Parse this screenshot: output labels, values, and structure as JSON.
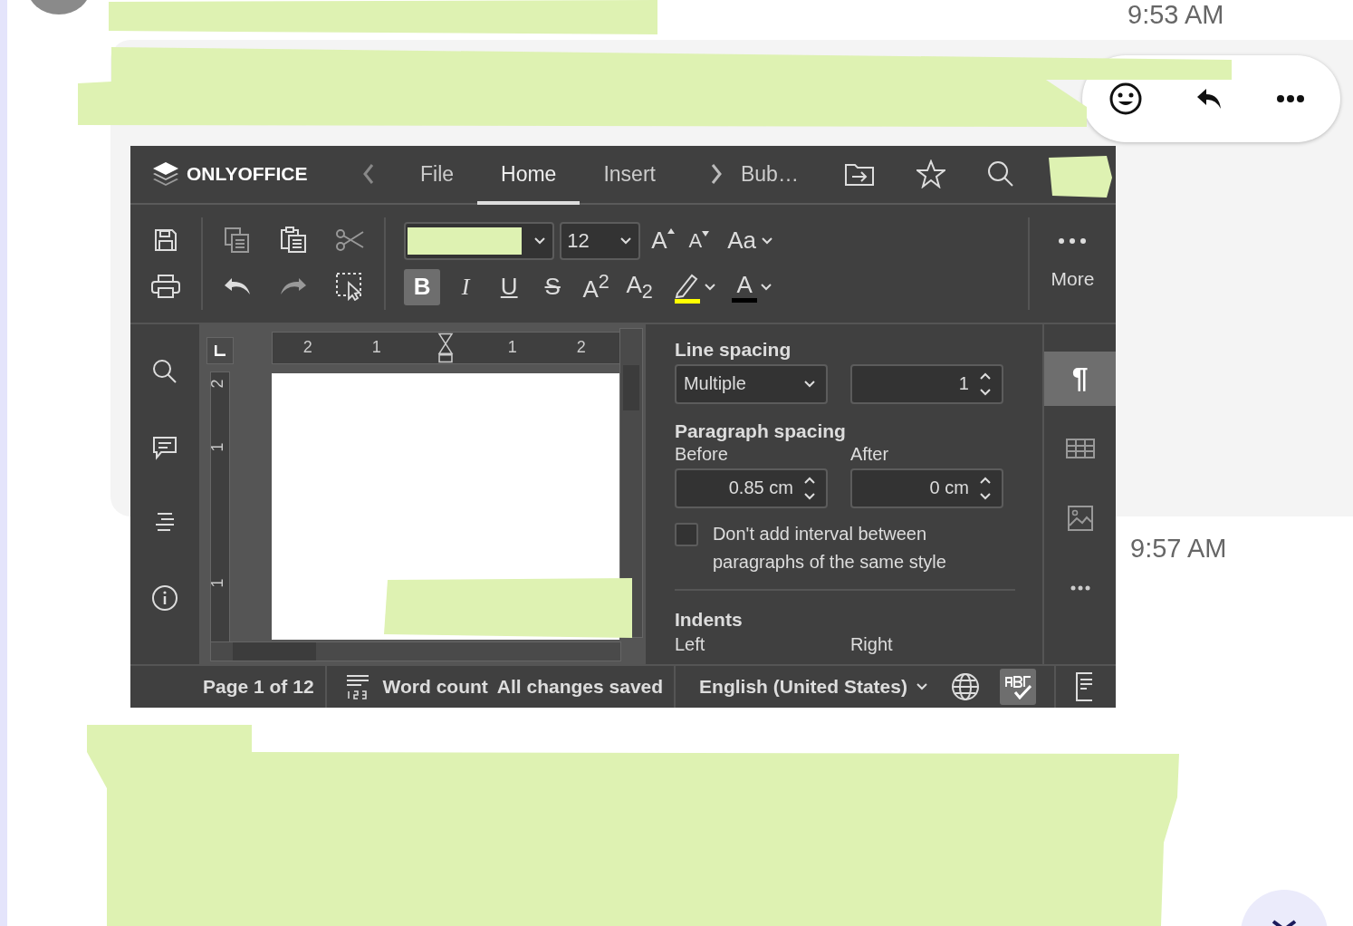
{
  "chat": {
    "timestamps": [
      "9:53 AM",
      "9:57 AM"
    ]
  },
  "editor": {
    "app_name": "ONLYOFFICE",
    "tabs": [
      {
        "label": "File",
        "selected": false
      },
      {
        "label": "Home",
        "selected": true
      },
      {
        "label": "Insert",
        "selected": false
      },
      {
        "label": "Bub…",
        "selected": false
      }
    ],
    "font_size": "12",
    "size_buttons": [
      {
        "kind": "grow",
        "label": "A"
      },
      {
        "kind": "shrink",
        "label": "A"
      }
    ],
    "case_button": "Aa",
    "format_buttons": [
      {
        "kind": "bold",
        "label": "B",
        "selected": true
      },
      {
        "kind": "italic",
        "label": "I",
        "selected": false
      },
      {
        "kind": "underline",
        "label": "U",
        "selected": false
      },
      {
        "kind": "strike",
        "label": "S",
        "selected": false
      },
      {
        "kind": "superscript",
        "label": "A$^{2}$",
        "selected": false
      },
      {
        "kind": "subscript",
        "label": "A$_{2}$",
        "selected": false
      }
    ],
    "color_buttons": [
      {
        "kind": "highlight",
        "color": "#ffff00"
      },
      {
        "kind": "font",
        "label": "A",
        "color": "#000000"
      }
    ],
    "more_label": "More",
    "ruler": {
      "horizontal": [
        "2",
        "1",
        "1",
        "2"
      ],
      "vertical": [
        "2",
        "1",
        "1"
      ]
    },
    "panel": {
      "line_spacing_title": "Line spacing",
      "line_spacing_mode": "Multiple",
      "line_spacing_value": "1",
      "paragraph_spacing_title": "Paragraph spacing",
      "before_label": "Before",
      "before_value": "0.85 cm",
      "after_label": "After",
      "after_value": "0 cm",
      "checkbox": {
        "label": "Don't add interval between paragraphs of the same style",
        "checked": false
      },
      "indents_title": "Indents",
      "left_label": "Left",
      "right_label": "Right"
    },
    "panel_tabs": [
      {
        "kind": "paragraph",
        "label": "¶",
        "selected": true
      },
      {
        "kind": "table",
        "selected": false
      },
      {
        "kind": "image",
        "selected": false
      },
      {
        "kind": "more",
        "selected": false
      }
    ],
    "status": {
      "page": "Page 1 of 12",
      "word_count": "Word count",
      "save_status": "All changes saved",
      "language": "English (United States)",
      "spellcheck_on": true
    }
  }
}
